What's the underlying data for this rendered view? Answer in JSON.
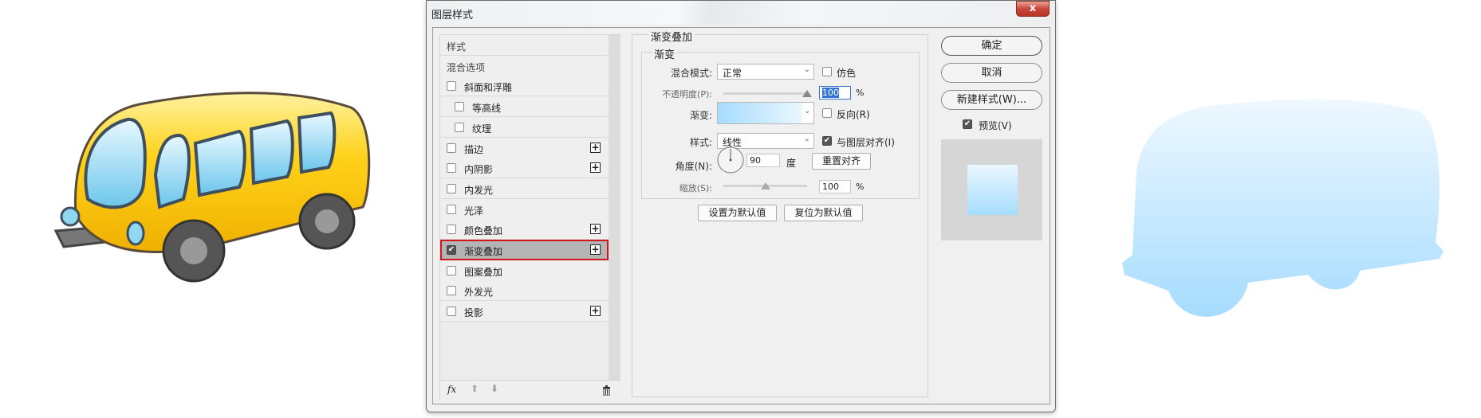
{
  "dialog": {
    "title": "图层样式",
    "close": "x"
  },
  "styles_list": {
    "items": [
      {
        "label": "样式",
        "checkbox": false,
        "checked": false,
        "plus": false,
        "indent": false
      },
      {
        "label": "混合选项",
        "checkbox": false,
        "checked": false,
        "plus": false,
        "indent": false
      },
      {
        "label": "斜面和浮雕",
        "checkbox": true,
        "checked": false,
        "plus": false,
        "indent": false
      },
      {
        "label": "等高线",
        "checkbox": true,
        "checked": false,
        "plus": false,
        "indent": true
      },
      {
        "label": "纹理",
        "checkbox": true,
        "checked": false,
        "plus": false,
        "indent": true
      },
      {
        "label": "描边",
        "checkbox": true,
        "checked": false,
        "plus": true,
        "indent": false
      },
      {
        "label": "内阴影",
        "checkbox": true,
        "checked": false,
        "plus": true,
        "indent": false
      },
      {
        "label": "内发光",
        "checkbox": true,
        "checked": false,
        "plus": false,
        "indent": false
      },
      {
        "label": "光泽",
        "checkbox": true,
        "checked": false,
        "plus": false,
        "indent": false
      },
      {
        "label": "颜色叠加",
        "checkbox": true,
        "checked": false,
        "plus": true,
        "indent": false
      },
      {
        "label": "渐变叠加",
        "checkbox": true,
        "checked": true,
        "plus": true,
        "indent": false,
        "selected": true
      },
      {
        "label": "图案叠加",
        "checkbox": true,
        "checked": false,
        "plus": false,
        "indent": false
      },
      {
        "label": "外发光",
        "checkbox": true,
        "checked": false,
        "plus": false,
        "indent": false
      },
      {
        "label": "投影",
        "checkbox": true,
        "checked": false,
        "plus": true,
        "indent": false
      }
    ],
    "footer": {
      "fx": "fx"
    }
  },
  "gradient_overlay": {
    "section_title": "渐变叠加",
    "group_title": "渐变",
    "blend_mode_label": "混合模式:",
    "blend_mode": "正常",
    "dither_label": "仿色",
    "dither": false,
    "opacity_label": "不透明度(P):",
    "opacity": "100",
    "opacity_unit": "%",
    "opacity_fraction": 1.0,
    "gradient_label": "渐变:",
    "reverse_label": "反向(R)",
    "reverse": false,
    "gradient_colors": [
      "#a6dcff",
      "#eaf7ff"
    ],
    "style_label": "样式:",
    "style": "线性",
    "align_label": "与图层对齐(I)",
    "align": true,
    "angle_label": "角度(N):",
    "angle": "90",
    "angle_unit": "度",
    "reset_align": "重置对齐",
    "scale_label": "缩放(S):",
    "scale": "100",
    "scale_unit": "%",
    "scale_fraction": 0.5,
    "make_default": "设置为默认值",
    "reset_default": "复位为默认值"
  },
  "actions": {
    "ok": "确定",
    "cancel": "取消",
    "new_style": "新建样式(W)...",
    "preview_label": "预览(V)",
    "preview": true
  }
}
